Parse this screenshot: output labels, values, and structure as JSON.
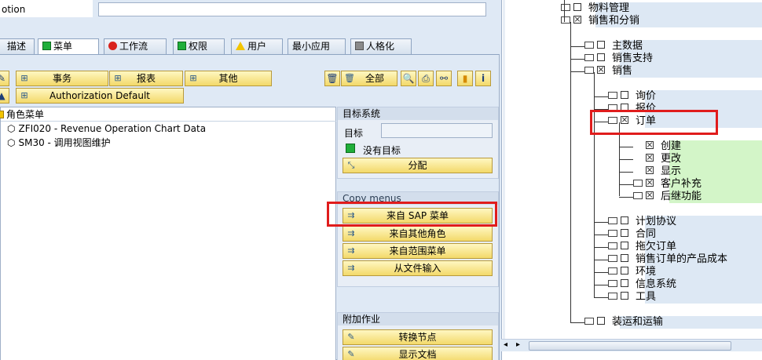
{
  "header": {
    "field_label": "otion"
  },
  "tabs": [
    {
      "label": "描述",
      "icon": "edit-icon",
      "active": false
    },
    {
      "label": "菜单",
      "icon": "green-square-icon",
      "active": true
    },
    {
      "label": "工作流",
      "icon": "red-circle-icon",
      "active": false
    },
    {
      "label": "权限",
      "icon": "green-square-icon",
      "active": false
    },
    {
      "label": "用户",
      "icon": "warning-triangle-icon",
      "active": false
    },
    {
      "label": "最小应用",
      "icon": "",
      "active": false
    },
    {
      "label": "人格化",
      "icon": "personalization-icon",
      "active": false
    }
  ],
  "toolbar": {
    "transaction": "事务",
    "report": "报表",
    "other": "其他",
    "all": "全部",
    "auth_default": "Authorization Default"
  },
  "role_menu": {
    "root": "角色菜单",
    "items": [
      "ZFI020 - Revenue Operation Chart Data",
      "SM30 - 调用视图维护"
    ]
  },
  "target_system": {
    "title": "目标系统",
    "target_label": "目标",
    "target_value": "",
    "status": "没有目标",
    "assign": "分配"
  },
  "copy_menus": {
    "title": "Copy menus",
    "from_sap": "来自 SAP 菜单",
    "from_role": "来自其他角色",
    "from_area": "来自范围菜单",
    "from_file": "从文件输入"
  },
  "extra": {
    "title": "附加作业",
    "convert": "转换节点",
    "show_doc": "显示文档"
  },
  "tree": [
    {
      "label": "物料管理",
      "kind": "folder",
      "checked": false,
      "indent": 1
    },
    {
      "label": "销售和分销",
      "kind": "folder-open",
      "checked": true,
      "indent": 1
    },
    {
      "label": "主数据",
      "kind": "folder",
      "checked": false,
      "indent": 2
    },
    {
      "label": "销售支持",
      "kind": "folder",
      "checked": false,
      "indent": 2
    },
    {
      "label": "销售",
      "kind": "folder-open",
      "checked": true,
      "indent": 2
    },
    {
      "label": "询价",
      "kind": "folder",
      "checked": false,
      "indent": 3
    },
    {
      "label": "报价",
      "kind": "folder",
      "checked": false,
      "indent": 3
    },
    {
      "label": "订单",
      "kind": "folder-open",
      "checked": true,
      "indent": 3
    },
    {
      "label": "创建",
      "kind": "leaf",
      "checked": true,
      "indent": 4
    },
    {
      "label": "更改",
      "kind": "leaf",
      "checked": true,
      "indent": 4
    },
    {
      "label": "显示",
      "kind": "leaf",
      "checked": true,
      "indent": 4
    },
    {
      "label": "客户补充",
      "kind": "folder",
      "checked": true,
      "indent": 4
    },
    {
      "label": "后继功能",
      "kind": "folder",
      "checked": true,
      "indent": 4
    },
    {
      "label": "计划协议",
      "kind": "folder",
      "checked": false,
      "indent": 3
    },
    {
      "label": "合同",
      "kind": "folder",
      "checked": false,
      "indent": 3
    },
    {
      "label": "拖欠订单",
      "kind": "folder",
      "checked": false,
      "indent": 3
    },
    {
      "label": "销售订单的产品成本",
      "kind": "folder",
      "checked": false,
      "indent": 3
    },
    {
      "label": "环境",
      "kind": "folder",
      "checked": false,
      "indent": 3
    },
    {
      "label": "信息系统",
      "kind": "folder",
      "checked": false,
      "indent": 3
    },
    {
      "label": "工具",
      "kind": "folder",
      "checked": false,
      "indent": 3
    },
    {
      "label": "装运和运输",
      "kind": "folder",
      "checked": false,
      "indent": 2
    }
  ],
  "colors": {
    "highlight": "#e01c1c",
    "row_green": "#d3f5c8",
    "row_blue": "#dde8f4"
  }
}
